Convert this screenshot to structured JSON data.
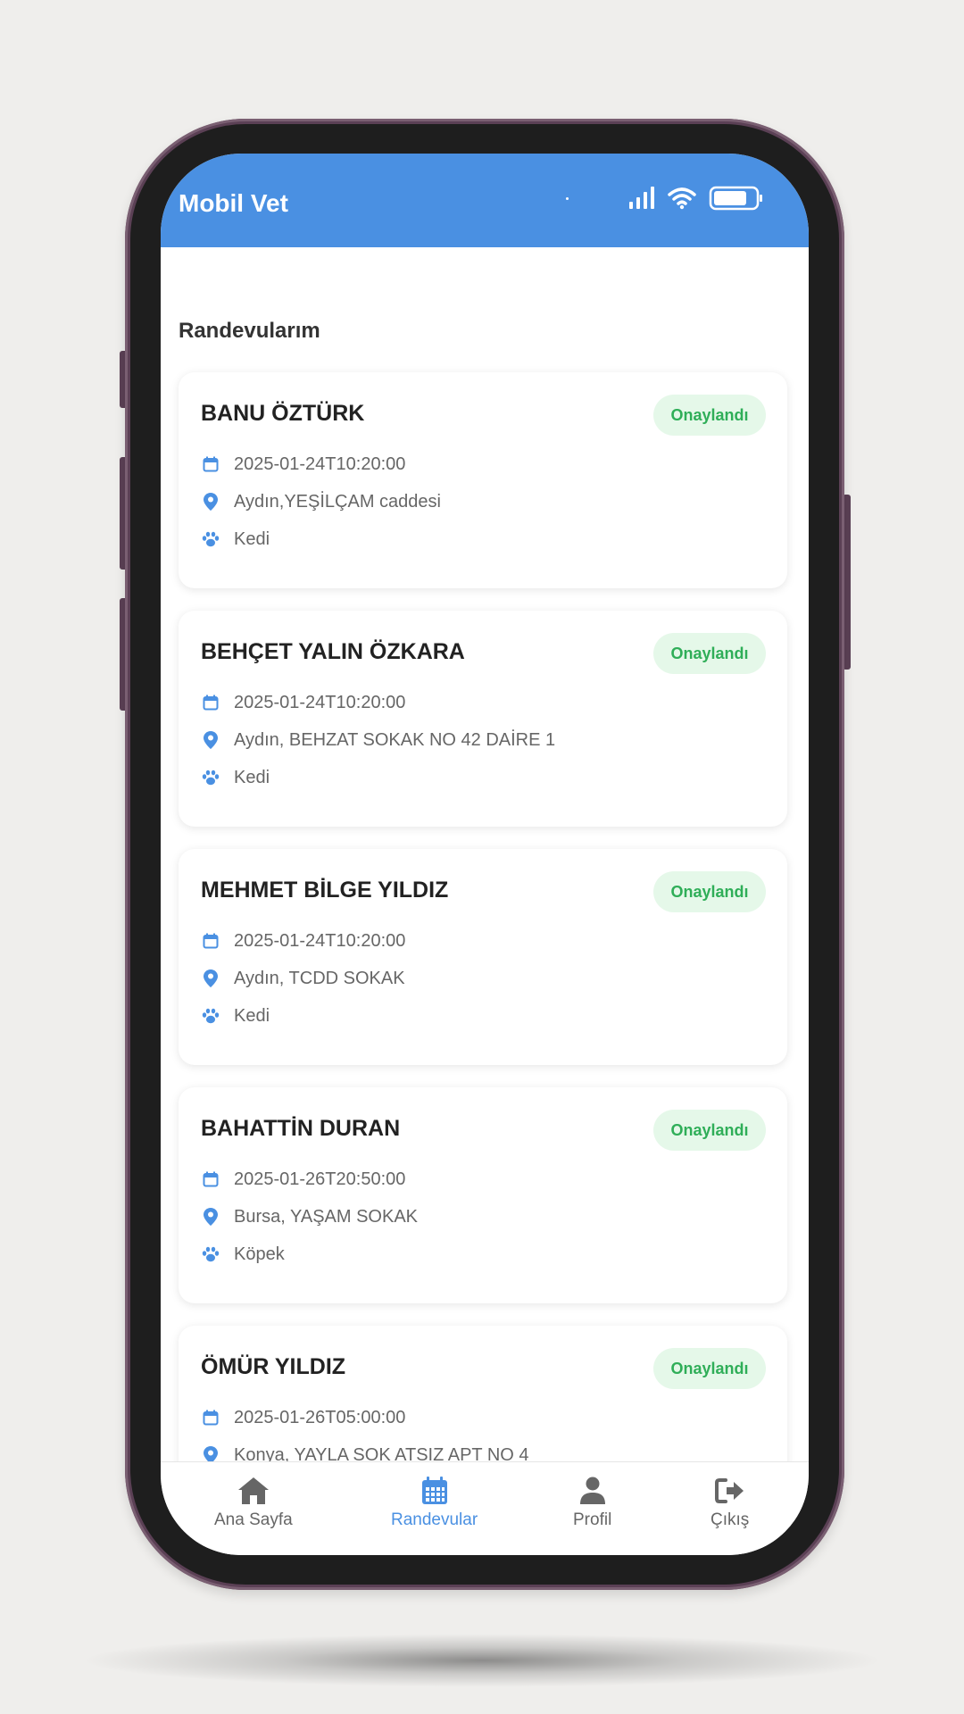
{
  "app": {
    "title": "Mobil Vet"
  },
  "colors": {
    "primary": "#4a90e2",
    "badge_bg": "#e5f8e9",
    "badge_text": "#2fae58"
  },
  "section_title": "Randevularım",
  "appointments": [
    {
      "name": "BANU ÖZTÜRK",
      "status": "Onaylandı",
      "date": "2025-01-24T10:20:00",
      "address": "Aydın,YEŞİLÇAM caddesi",
      "pet": "Kedi"
    },
    {
      "name": "BEHÇET YALIN ÖZKARA",
      "status": "Onaylandı",
      "date": "2025-01-24T10:20:00",
      "address": "Aydın, BEHZAT SOKAK NO 42 DAİRE 1",
      "pet": "Kedi"
    },
    {
      "name": "MEHMET BİLGE YILDIZ",
      "status": "Onaylandı",
      "date": "2025-01-24T10:20:00",
      "address": "Aydın, TCDD SOKAK",
      "pet": "Kedi"
    },
    {
      "name": "BAHATTİN DURAN",
      "status": "Onaylandı",
      "date": "2025-01-26T20:50:00",
      "address": "Bursa, YAŞAM SOKAK",
      "pet": "Köpek"
    },
    {
      "name": "ÖMÜR YILDIZ",
      "status": "Onaylandı",
      "date": "2025-01-26T05:00:00",
      "address": "Konya, YAYLA SOK ATSIZ APT NO 4",
      "pet": ""
    }
  ],
  "icons": {
    "date": "calendar-icon",
    "address": "location-pin-icon",
    "pet": "paw-icon"
  },
  "bottom_nav": [
    {
      "label": "Ana Sayfa",
      "icon": "home-icon",
      "active": false
    },
    {
      "label": "Randevular",
      "icon": "calendar-icon",
      "active": true
    },
    {
      "label": "Profil",
      "icon": "user-icon",
      "active": false
    },
    {
      "label": "Çıkış",
      "icon": "logout-icon",
      "active": false
    }
  ]
}
